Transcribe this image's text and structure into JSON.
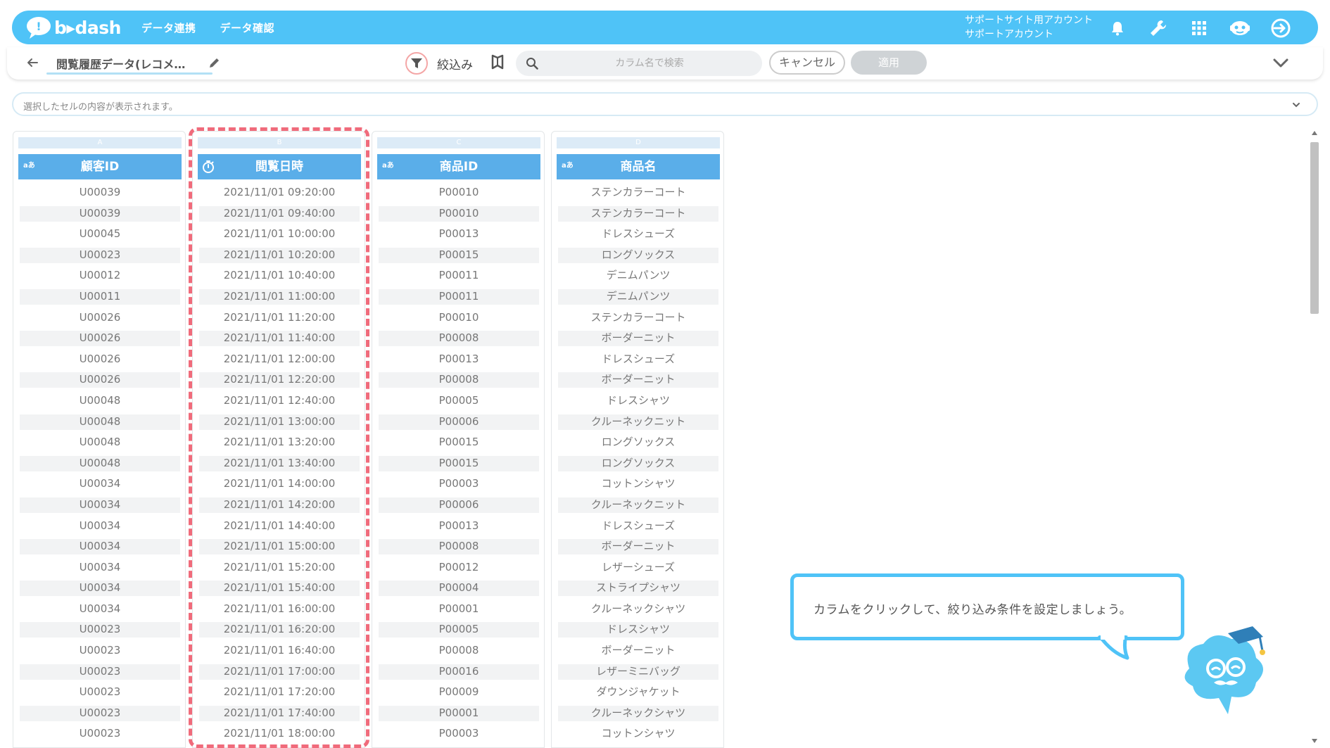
{
  "header": {
    "logo_text": "b▸dash",
    "nav": [
      "データ連携",
      "データ確認"
    ],
    "account_line1": "サポートサイト用アカウント",
    "account_line2": "サポートアカウント",
    "icons": [
      "bell-icon",
      "wrench-icon",
      "grid-apps-icon",
      "robot-icon",
      "logout-icon"
    ]
  },
  "toolbar": {
    "title": "閲覧履歴データ(レコメ…",
    "filter_label": "絞込み",
    "search_placeholder": "カラム名で検索",
    "cancel_label": "キャンセル",
    "apply_label": "適用"
  },
  "cellbar": {
    "placeholder": "選択したセルの内容が表示されます。"
  },
  "columns": [
    {
      "letter": "A",
      "type_badge": "aあ",
      "header": "顧客ID",
      "cells": [
        "U00039",
        "U00039",
        "U00045",
        "U00023",
        "U00012",
        "U00011",
        "U00026",
        "U00026",
        "U00026",
        "U00026",
        "U00048",
        "U00048",
        "U00048",
        "U00048",
        "U00034",
        "U00034",
        "U00034",
        "U00034",
        "U00034",
        "U00034",
        "U00034",
        "U00023",
        "U00023",
        "U00023",
        "U00023",
        "U00023",
        "U00023"
      ]
    },
    {
      "letter": "B",
      "type_badge": "",
      "header": "閲覧日時",
      "cells": [
        "2021/11/01 09:20:00",
        "2021/11/01 09:40:00",
        "2021/11/01 10:00:00",
        "2021/11/01 10:20:00",
        "2021/11/01 10:40:00",
        "2021/11/01 11:00:00",
        "2021/11/01 11:20:00",
        "2021/11/01 11:40:00",
        "2021/11/01 12:00:00",
        "2021/11/01 12:20:00",
        "2021/11/01 12:40:00",
        "2021/11/01 13:00:00",
        "2021/11/01 13:20:00",
        "2021/11/01 13:40:00",
        "2021/11/01 14:00:00",
        "2021/11/01 14:20:00",
        "2021/11/01 14:40:00",
        "2021/11/01 15:00:00",
        "2021/11/01 15:20:00",
        "2021/11/01 15:40:00",
        "2021/11/01 16:00:00",
        "2021/11/01 16:20:00",
        "2021/11/01 16:40:00",
        "2021/11/01 17:00:00",
        "2021/11/01 17:20:00",
        "2021/11/01 17:40:00",
        "2021/11/01 18:00:00"
      ]
    },
    {
      "letter": "C",
      "type_badge": "aあ",
      "header": "商品ID",
      "cells": [
        "P00010",
        "P00010",
        "P00013",
        "P00015",
        "P00011",
        "P00011",
        "P00010",
        "P00008",
        "P00013",
        "P00008",
        "P00005",
        "P00006",
        "P00015",
        "P00015",
        "P00003",
        "P00006",
        "P00013",
        "P00008",
        "P00012",
        "P00004",
        "P00001",
        "P00005",
        "P00008",
        "P00016",
        "P00009",
        "P00001",
        "P00003"
      ]
    },
    {
      "letter": "D",
      "type_badge": "aあ",
      "header": "商品名",
      "cells": [
        "ステンカラーコート",
        "ステンカラーコート",
        "ドレスシューズ",
        "ロングソックス",
        "デニムパンツ",
        "デニムパンツ",
        "ステンカラーコート",
        "ボーダーニット",
        "ドレスシューズ",
        "ボーダーニット",
        "ドレスシャツ",
        "クルーネックニット",
        "ロングソックス",
        "ロングソックス",
        "コットンシャツ",
        "クルーネックニット",
        "ドレスシューズ",
        "ボーダーニット",
        "レザーシューズ",
        "ストライプシャツ",
        "クルーネックシャツ",
        "ドレスシャツ",
        "ボーダーニット",
        "レザーミニバッグ",
        "ダウンジャケット",
        "クルーネックシャツ",
        "コットンシャツ"
      ]
    }
  ],
  "tooltip": {
    "text": "カラムをクリックして、絞り込み条件を設定しましょう。"
  },
  "colors": {
    "brand": "#4fc3f7",
    "header_blue": "#5aaee9",
    "highlight": "#f06b7b"
  }
}
